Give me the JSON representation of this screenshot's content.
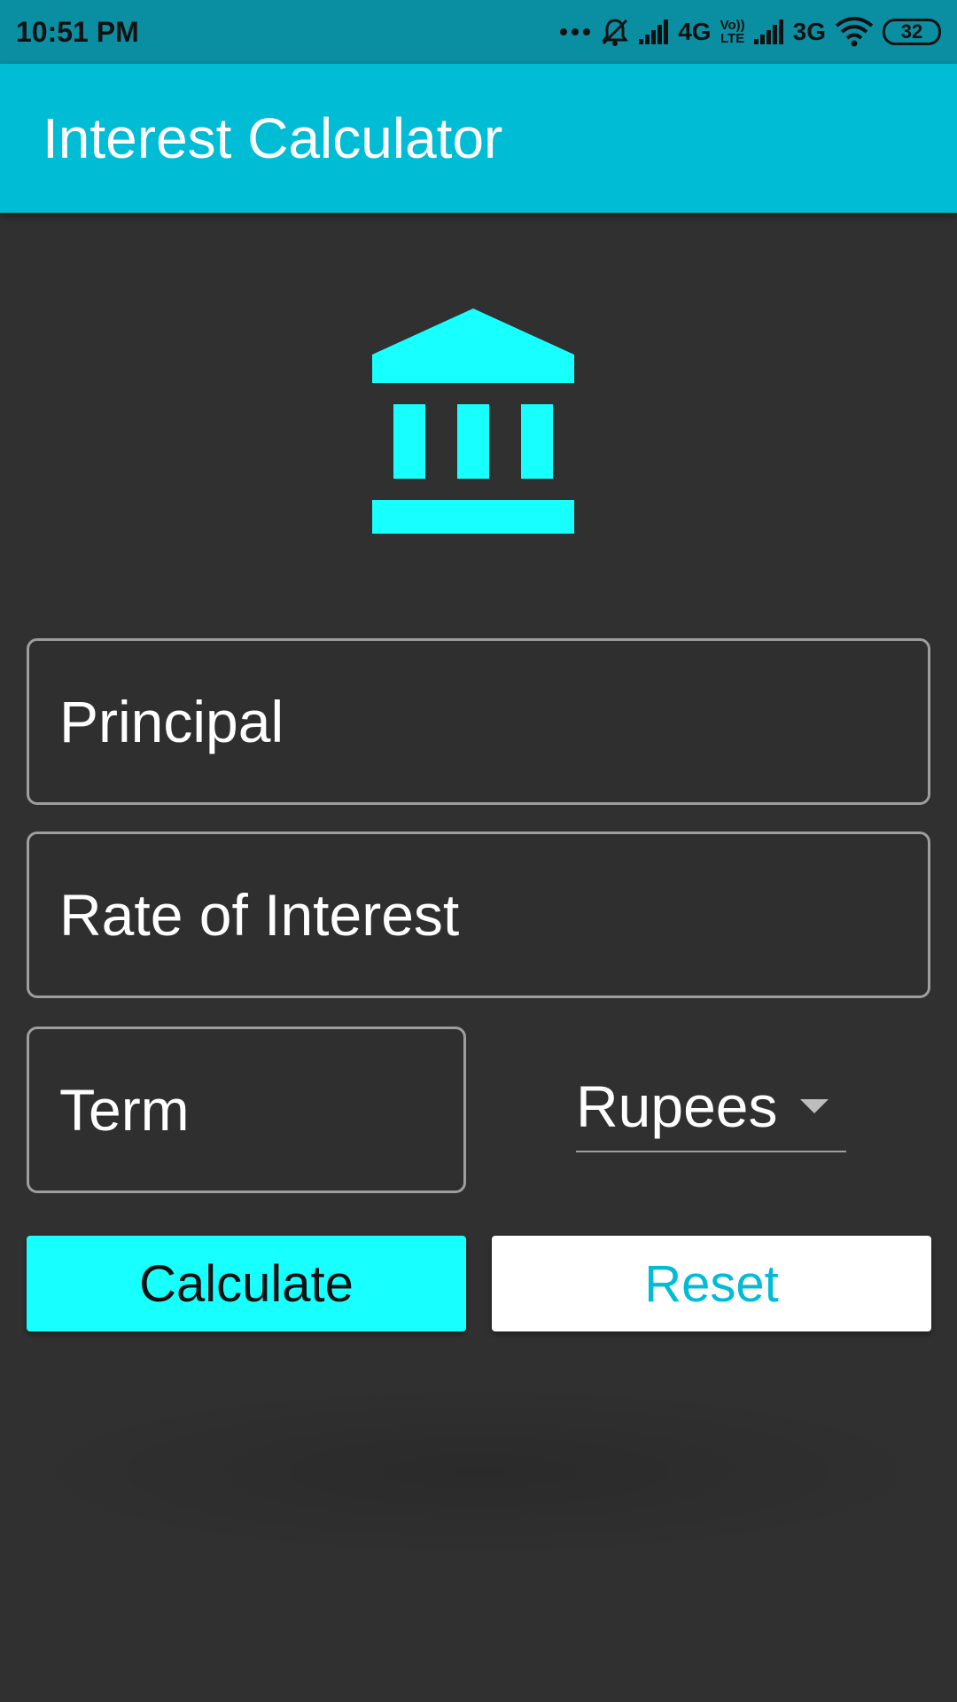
{
  "status_bar": {
    "time": "10:51 PM",
    "network_1": "4G",
    "volte_top": "Vo))",
    "volte_bottom": "LTE",
    "network_2": "3G",
    "battery": "32"
  },
  "app_bar": {
    "title": "Interest Calculator",
    "color": "#00bcd4"
  },
  "header_icon": {
    "name": "bank-icon",
    "color": "#18ffff"
  },
  "form": {
    "principal_placeholder": "Principal",
    "rate_placeholder": "Rate of Interest",
    "term_placeholder": "Term",
    "currency_selected": "Rupees"
  },
  "buttons": {
    "calculate_label": "Calculate",
    "reset_label": "Reset"
  },
  "colors": {
    "background": "#303030",
    "accent": "#18ffff",
    "primary": "#00bcd4"
  }
}
